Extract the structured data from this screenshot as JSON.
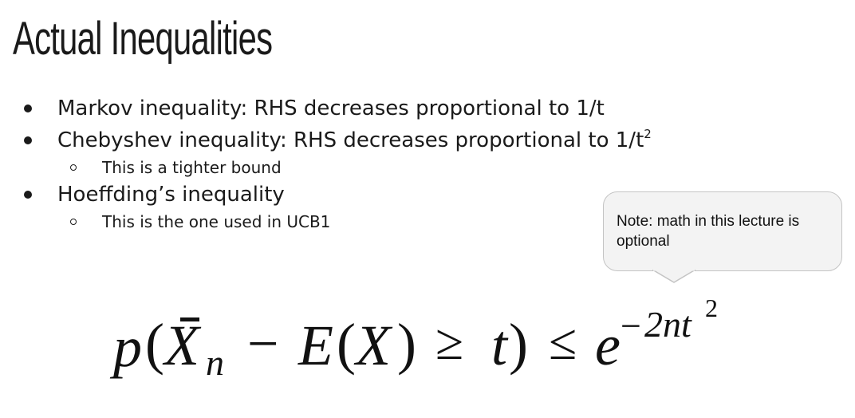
{
  "slide": {
    "title": "Actual Inequalities",
    "bullets": [
      {
        "text": "Markov inequality: RHS decreases proportional to 1/t",
        "sup": ""
      },
      {
        "text": "Chebyshev inequality: RHS decreases proportional to 1/t",
        "sup": "2"
      },
      {
        "text": "This is a tighter bound"
      },
      {
        "text": "Hoeffding’s inequality"
      },
      {
        "text": "This is the one used in UCB1"
      }
    ],
    "callout": {
      "text": "Note: math in this lecture is optional"
    },
    "formula": {
      "p": "p",
      "lparen": "(",
      "X": "X",
      "bar": "¯",
      "n": "n",
      "minus": "−",
      "E": "E",
      "lparen2": "(",
      "X2": "X",
      "rparen2": ")",
      "geq": "≥",
      "t": "t",
      "rparen": ")",
      "leq": "≤",
      "e": "e",
      "exp_minus": "−",
      "exp_2nt": "2nt",
      "exp_sq": "2"
    }
  }
}
